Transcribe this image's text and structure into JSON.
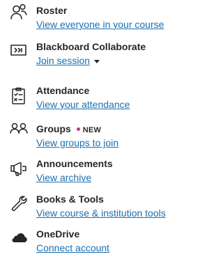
{
  "tools": [
    {
      "title": "Roster",
      "link": "View everyone in your course",
      "icon": "roster-icon"
    },
    {
      "title": "Blackboard Collaborate",
      "link": "Join session",
      "icon": "collaborate-icon",
      "has_dropdown": true
    },
    {
      "title": "Attendance",
      "link": "View your attendance",
      "icon": "attendance-icon"
    },
    {
      "title": "Groups",
      "link": "View groups to join",
      "icon": "groups-icon",
      "badge": "NEW"
    },
    {
      "title": "Announcements",
      "link": "View archive",
      "icon": "megaphone-icon"
    },
    {
      "title": "Books & Tools",
      "link": "View course & institution tools",
      "icon": "wrench-icon"
    },
    {
      "title": "OneDrive",
      "link": "Connect account",
      "icon": "cloud-icon"
    }
  ],
  "colors": {
    "link": "#1a6fb0",
    "text": "#262626",
    "badge_dot": "#c3398c"
  }
}
